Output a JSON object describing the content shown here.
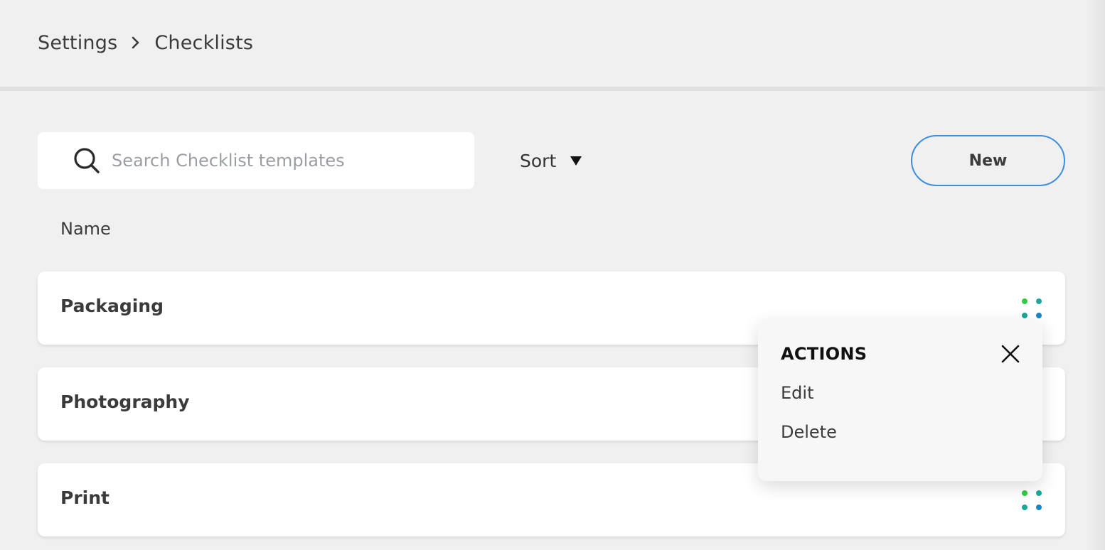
{
  "breadcrumb": {
    "root": "Settings",
    "current": "Checklists"
  },
  "search": {
    "placeholder": "Search Checklist templates",
    "value": ""
  },
  "sort": {
    "label": "Sort"
  },
  "new_button": {
    "label": "New"
  },
  "table": {
    "column_name": "Name"
  },
  "rows": [
    {
      "label": "Packaging"
    },
    {
      "label": "Photography"
    },
    {
      "label": "Print"
    }
  ],
  "actions_menu": {
    "title": "ACTIONS",
    "items": [
      {
        "label": "Edit"
      },
      {
        "label": "Delete"
      }
    ]
  },
  "colors": {
    "accent_border": "#3a8fe0",
    "dot_green": "#2ecc40",
    "dot_teal": "#1aa899",
    "dot_blue": "#1a86c8",
    "background": "#f0f0f0"
  },
  "icons": {
    "search": "search-icon",
    "breadcrumb_separator": "chevron-right-icon",
    "sort": "caret-down-icon",
    "row_menu": "dots-grid-icon",
    "close": "close-icon"
  }
}
